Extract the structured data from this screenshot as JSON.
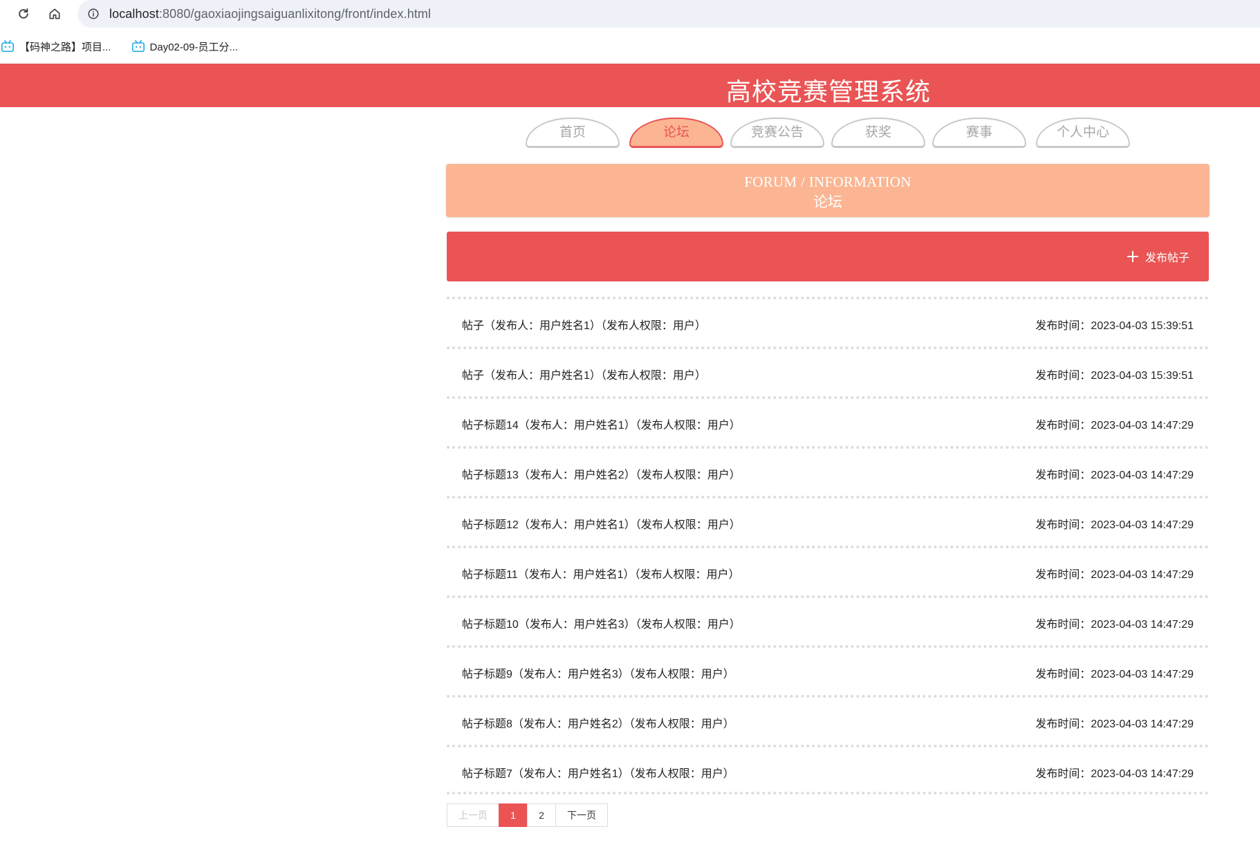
{
  "browser": {
    "url_host": "localhost",
    "url_rest": ":8080/gaoxiaojingsaiguanlixitong/front/index.html",
    "bookmarks": [
      {
        "label": "【码神之路】项目..."
      },
      {
        "label": "Day02-09-员工分..."
      }
    ]
  },
  "header": {
    "title": "高校竞赛管理系统"
  },
  "nav": {
    "tabs": [
      {
        "label": "首页",
        "active": false
      },
      {
        "label": "论坛",
        "active": true
      },
      {
        "label": "竞赛公告",
        "active": false
      },
      {
        "label": "获奖",
        "active": false
      },
      {
        "label": "赛事",
        "active": false
      },
      {
        "label": "个人中心",
        "active": false
      }
    ]
  },
  "banner": {
    "en": "FORUM / INFORMATION",
    "cn": "论坛"
  },
  "actions": {
    "publish_label": "发布帖子"
  },
  "posts": [
    {
      "title": "帖子（发布人：用户姓名1）（发布人权限：用户）",
      "time": "发布时间：2023-04-03 15:39:51"
    },
    {
      "title": "帖子（发布人：用户姓名1）（发布人权限：用户）",
      "time": "发布时间：2023-04-03 15:39:51"
    },
    {
      "title": "帖子标题14（发布人：用户姓名1）（发布人权限：用户）",
      "time": "发布时间：2023-04-03 14:47:29"
    },
    {
      "title": "帖子标题13（发布人：用户姓名2）（发布人权限：用户）",
      "time": "发布时间：2023-04-03 14:47:29"
    },
    {
      "title": "帖子标题12（发布人：用户姓名1）（发布人权限：用户）",
      "time": "发布时间：2023-04-03 14:47:29"
    },
    {
      "title": "帖子标题11（发布人：用户姓名1）（发布人权限：用户）",
      "time": "发布时间：2023-04-03 14:47:29"
    },
    {
      "title": "帖子标题10（发布人：用户姓名3）（发布人权限：用户）",
      "time": "发布时间：2023-04-03 14:47:29"
    },
    {
      "title": "帖子标题9（发布人：用户姓名3）（发布人权限：用户）",
      "time": "发布时间：2023-04-03 14:47:29"
    },
    {
      "title": "帖子标题8（发布人：用户姓名2）（发布人权限：用户）",
      "time": "发布时间：2023-04-03 14:47:29"
    },
    {
      "title": "帖子标题7（发布人：用户姓名1）（发布人权限：用户）",
      "time": "发布时间：2023-04-03 14:47:29"
    }
  ],
  "pagination": {
    "prev": "上一页",
    "pages": [
      "1",
      "2"
    ],
    "current": "1",
    "next": "下一页"
  },
  "colors": {
    "primary": "#ea5455",
    "secondary": "#fbb592"
  },
  "icons": {
    "reload": "reload-icon",
    "home": "home-icon",
    "site_info": "info-icon",
    "bookmark": "bilibili-icon",
    "publish": "plus-icon"
  }
}
